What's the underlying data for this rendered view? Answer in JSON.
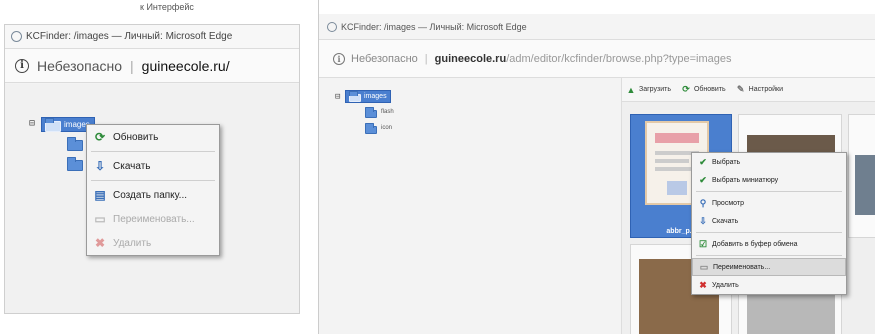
{
  "left": {
    "top_crop_text": "к Интерфейс",
    "window_title": "KCFinder: /images — Личный: Microsoft Edge",
    "address": {
      "insecure_label": "Небезопасно",
      "separator": "|",
      "domain": "guineecole.ru/"
    },
    "tree": {
      "expander": "⊟",
      "selected_folder": "images"
    },
    "context_menu": [
      {
        "label": "Обновить",
        "icon": "refresh-icon",
        "disabled": false
      },
      {
        "label": "Скачать",
        "icon": "download-icon",
        "disabled": false
      },
      {
        "label": "Создать папку...",
        "icon": "new-folder-icon",
        "disabled": false
      },
      {
        "label": "Переименовать...",
        "icon": "rename-icon",
        "disabled": true
      },
      {
        "label": "Удалить",
        "icon": "delete-icon",
        "disabled": true
      }
    ]
  },
  "right": {
    "window_title": "KCFinder: /images — Личный: Microsoft Edge",
    "address": {
      "insecure_label": "Небезопасно",
      "separator": "|",
      "domain": "guineecole.ru",
      "path": "/adm/editor/kcfinder/browse.php?type=images"
    },
    "tree": {
      "expander": "⊟",
      "root": "images",
      "children": [
        "flash",
        "icon"
      ]
    },
    "toolbar": [
      {
        "label": "Загрузить",
        "icon": "upload-icon"
      },
      {
        "label": "Обновить",
        "icon": "refresh-icon"
      },
      {
        "label": "Настройки",
        "icon": "settings-icon"
      }
    ],
    "thumb_caption": "abbr_p...",
    "context_menu": [
      {
        "label": "Выбрать",
        "icon": "check-icon",
        "disabled": false
      },
      {
        "label": "Выбрать миниатюру",
        "icon": "check-icon",
        "disabled": false
      },
      {
        "label": "Просмотр",
        "icon": "view-icon",
        "disabled": false
      },
      {
        "label": "Скачать",
        "icon": "download-icon",
        "disabled": false
      },
      {
        "label": "Добавить в буфер обмена",
        "icon": "clipboard-icon",
        "disabled": false
      },
      {
        "label": "Переименовать...",
        "icon": "rename-icon",
        "disabled": false,
        "highlighted": true
      },
      {
        "label": "Удалить",
        "icon": "delete-icon",
        "disabled": false
      }
    ]
  },
  "colors": {
    "selection_blue": "#4a7fcf",
    "refresh_green": "#2e8b3a",
    "delete_red": "#d03030"
  }
}
